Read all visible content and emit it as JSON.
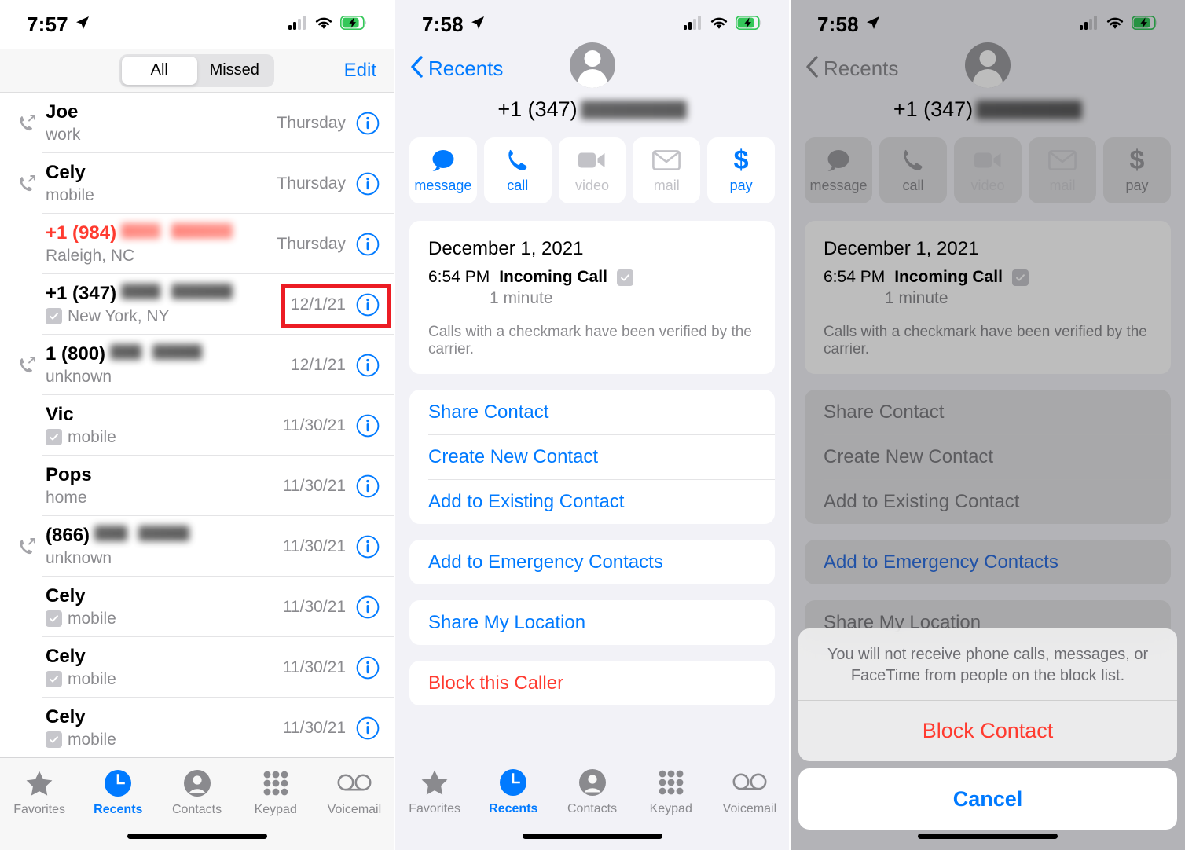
{
  "panel1": {
    "status": {
      "time": "7:57",
      "location_icon": "location-arrow-icon",
      "cellular_icon": "cellular-bars-icon",
      "wifi_icon": "wifi-icon",
      "battery_icon": "battery-charging-icon"
    },
    "header": {
      "segment_all": "All",
      "segment_missed": "Missed",
      "selected_segment": "All",
      "edit": "Edit"
    },
    "calls": [
      {
        "icon": "outgoing-call-icon",
        "name": "Joe",
        "name_blur": 0,
        "sub": "work",
        "verified": false,
        "date": "Thursday",
        "missed": false
      },
      {
        "icon": "outgoing-call-icon",
        "name": "Cely",
        "name_blur": 0,
        "sub": "mobile",
        "verified": false,
        "date": "Thursday",
        "missed": false
      },
      {
        "icon": "",
        "name": "+1 (984)",
        "name_blur": 155,
        "sub": "Raleigh, NC",
        "verified": false,
        "date": "Thursday",
        "missed": true
      },
      {
        "icon": "",
        "name": "+1 (347)",
        "name_blur": 155,
        "sub": "New York, NY",
        "verified": true,
        "date": "12/1/21",
        "missed": false
      },
      {
        "icon": "outgoing-call-icon",
        "name": "1 (800)",
        "name_blur": 125,
        "sub": "unknown",
        "verified": false,
        "date": "12/1/21",
        "missed": false
      },
      {
        "icon": "",
        "name": "Vic",
        "name_blur": 0,
        "sub": "mobile",
        "verified": true,
        "date": "11/30/21",
        "missed": false
      },
      {
        "icon": "",
        "name": "Pops",
        "name_blur": 0,
        "sub": "home",
        "verified": false,
        "date": "11/30/21",
        "missed": false
      },
      {
        "icon": "outgoing-call-icon",
        "name": "(866)",
        "name_blur": 130,
        "sub": "unknown",
        "verified": false,
        "date": "11/30/21",
        "missed": false
      },
      {
        "icon": "",
        "name": "Cely",
        "name_blur": 0,
        "sub": "mobile",
        "verified": true,
        "date": "11/30/21",
        "missed": false
      },
      {
        "icon": "",
        "name": "Cely",
        "name_blur": 0,
        "sub": "mobile",
        "verified": true,
        "date": "11/30/21",
        "missed": false
      },
      {
        "icon": "",
        "name": "Cely",
        "name_blur": 0,
        "sub": "mobile",
        "verified": true,
        "date": "11/30/21",
        "missed": false
      }
    ],
    "tabs": [
      {
        "label": "Favorites",
        "icon": "star-icon",
        "active": false
      },
      {
        "label": "Recents",
        "icon": "clock-icon",
        "active": true
      },
      {
        "label": "Contacts",
        "icon": "person-circle-icon",
        "active": false
      },
      {
        "label": "Keypad",
        "icon": "keypad-dots-icon",
        "active": false
      },
      {
        "label": "Voicemail",
        "icon": "voicemail-icon",
        "active": false
      }
    ]
  },
  "panel2": {
    "status": {
      "time": "7:58"
    },
    "nav": {
      "back_label": "Recents",
      "back_icon": "chevron-left-icon"
    },
    "contact": {
      "avatar_icon": "person-avatar-icon",
      "phone": "+1 (347)"
    },
    "quick_actions": [
      {
        "label": "message",
        "icon": "message-bubble-icon",
        "enabled": true
      },
      {
        "label": "call",
        "icon": "phone-handset-icon",
        "enabled": true
      },
      {
        "label": "video",
        "icon": "video-camera-icon",
        "enabled": false
      },
      {
        "label": "mail",
        "icon": "envelope-icon",
        "enabled": false
      },
      {
        "label": "pay",
        "icon": "dollar-sign-icon",
        "enabled": true
      }
    ],
    "call_card": {
      "date": "December 1, 2021",
      "time": "6:54 PM",
      "type": "Incoming Call",
      "verified_icon": "verified-checkmark-icon",
      "duration": "1 minute",
      "note": "Calls with a checkmark have been verified by the carrier."
    },
    "groups": [
      {
        "items": [
          {
            "label": "Share Contact",
            "destructive": false
          },
          {
            "label": "Create New Contact",
            "destructive": false
          },
          {
            "label": "Add to Existing Contact",
            "destructive": false
          }
        ]
      },
      {
        "items": [
          {
            "label": "Add to Emergency Contacts",
            "destructive": false
          }
        ]
      },
      {
        "items": [
          {
            "label": "Share My Location",
            "destructive": false
          }
        ]
      },
      {
        "items": [
          {
            "label": "Block this Caller",
            "destructive": true
          }
        ]
      }
    ],
    "tabs": [
      {
        "label": "Favorites",
        "icon": "star-icon",
        "active": false
      },
      {
        "label": "Recents",
        "icon": "clock-icon",
        "active": true
      },
      {
        "label": "Contacts",
        "icon": "person-circle-icon",
        "active": false
      },
      {
        "label": "Keypad",
        "icon": "keypad-dots-icon",
        "active": false
      },
      {
        "label": "Voicemail",
        "icon": "voicemail-icon",
        "active": false
      }
    ]
  },
  "panel3": {
    "status": {
      "time": "7:58"
    },
    "nav": {
      "back_label": "Recents",
      "back_icon": "chevron-left-icon"
    },
    "contact": {
      "avatar_icon": "person-avatar-icon",
      "phone": "+1 (347)"
    },
    "quick_actions": [
      {
        "label": "message",
        "icon": "message-bubble-icon"
      },
      {
        "label": "call",
        "icon": "phone-handset-icon"
      },
      {
        "label": "video",
        "icon": "video-camera-icon"
      },
      {
        "label": "mail",
        "icon": "envelope-icon"
      },
      {
        "label": "pay",
        "icon": "dollar-sign-icon"
      }
    ],
    "call_card": {
      "date": "December 1, 2021",
      "time": "6:54 PM",
      "type": "Incoming Call",
      "duration": "1 minute",
      "note": "Calls with a checkmark have been verified by the carrier."
    },
    "groups": [
      {
        "items": [
          {
            "label": "Share Contact",
            "highlight": false
          },
          {
            "label": "Create New Contact",
            "highlight": false
          },
          {
            "label": "Add to Existing Contact",
            "highlight": false
          }
        ]
      },
      {
        "items": [
          {
            "label": "Add to Emergency Contacts",
            "highlight": true
          }
        ]
      },
      {
        "items": [
          {
            "label": "Share My Location",
            "highlight": false
          }
        ]
      }
    ],
    "action_sheet": {
      "message": "You will not receive phone calls, messages, or FaceTime from people on the block list.",
      "block_label": "Block Contact",
      "cancel_label": "Cancel"
    }
  },
  "annotations": {
    "highlight_color": "#ec1c24",
    "boxes": [
      {
        "name": "date-cell-highlight"
      },
      {
        "name": "block-this-caller-highlight"
      },
      {
        "name": "block-contact-highlight"
      }
    ]
  },
  "colors": {
    "accent_blue": "#007aff",
    "destructive_red": "#ff3b30",
    "annotation_red": "#ec1c24",
    "secondary_gray": "#8a8a8e"
  }
}
